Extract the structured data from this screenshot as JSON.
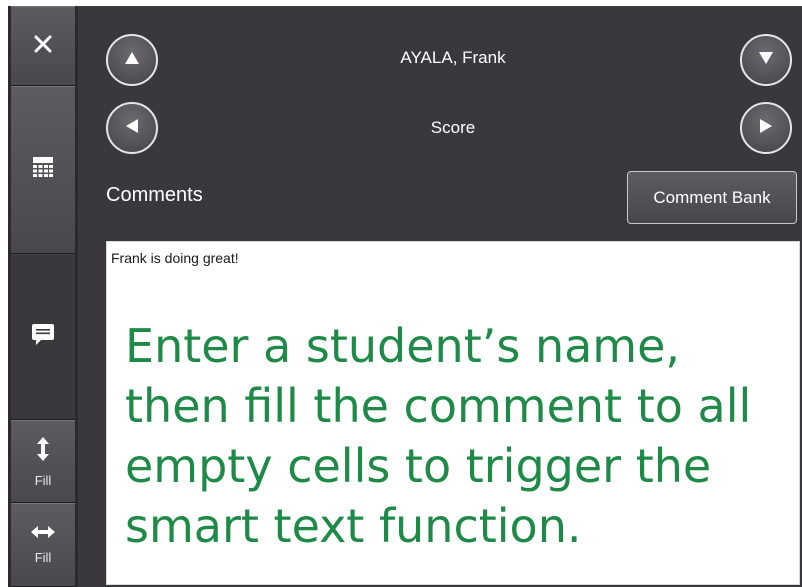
{
  "sidebar": {
    "close_icon": "close-icon",
    "gradebook_icon": "grid-calculator-icon",
    "comment_icon": "speech-bubble-icon",
    "fill_vertical_label": "Fill",
    "fill_horizontal_label": "Fill"
  },
  "header": {
    "student_name": "AYALA, Frank",
    "column_name": "Score"
  },
  "comments": {
    "label": "Comments",
    "comment_bank_label": "Comment Bank",
    "text": "Frank is doing great!",
    "overlay_instruction": "Enter a student’s name, then fill the comment to all empty cells to trigger the smart text function."
  },
  "colors": {
    "background": "#3a383d",
    "sidebar": "#2b2a2e",
    "instruction_text": "#1f8a48"
  }
}
